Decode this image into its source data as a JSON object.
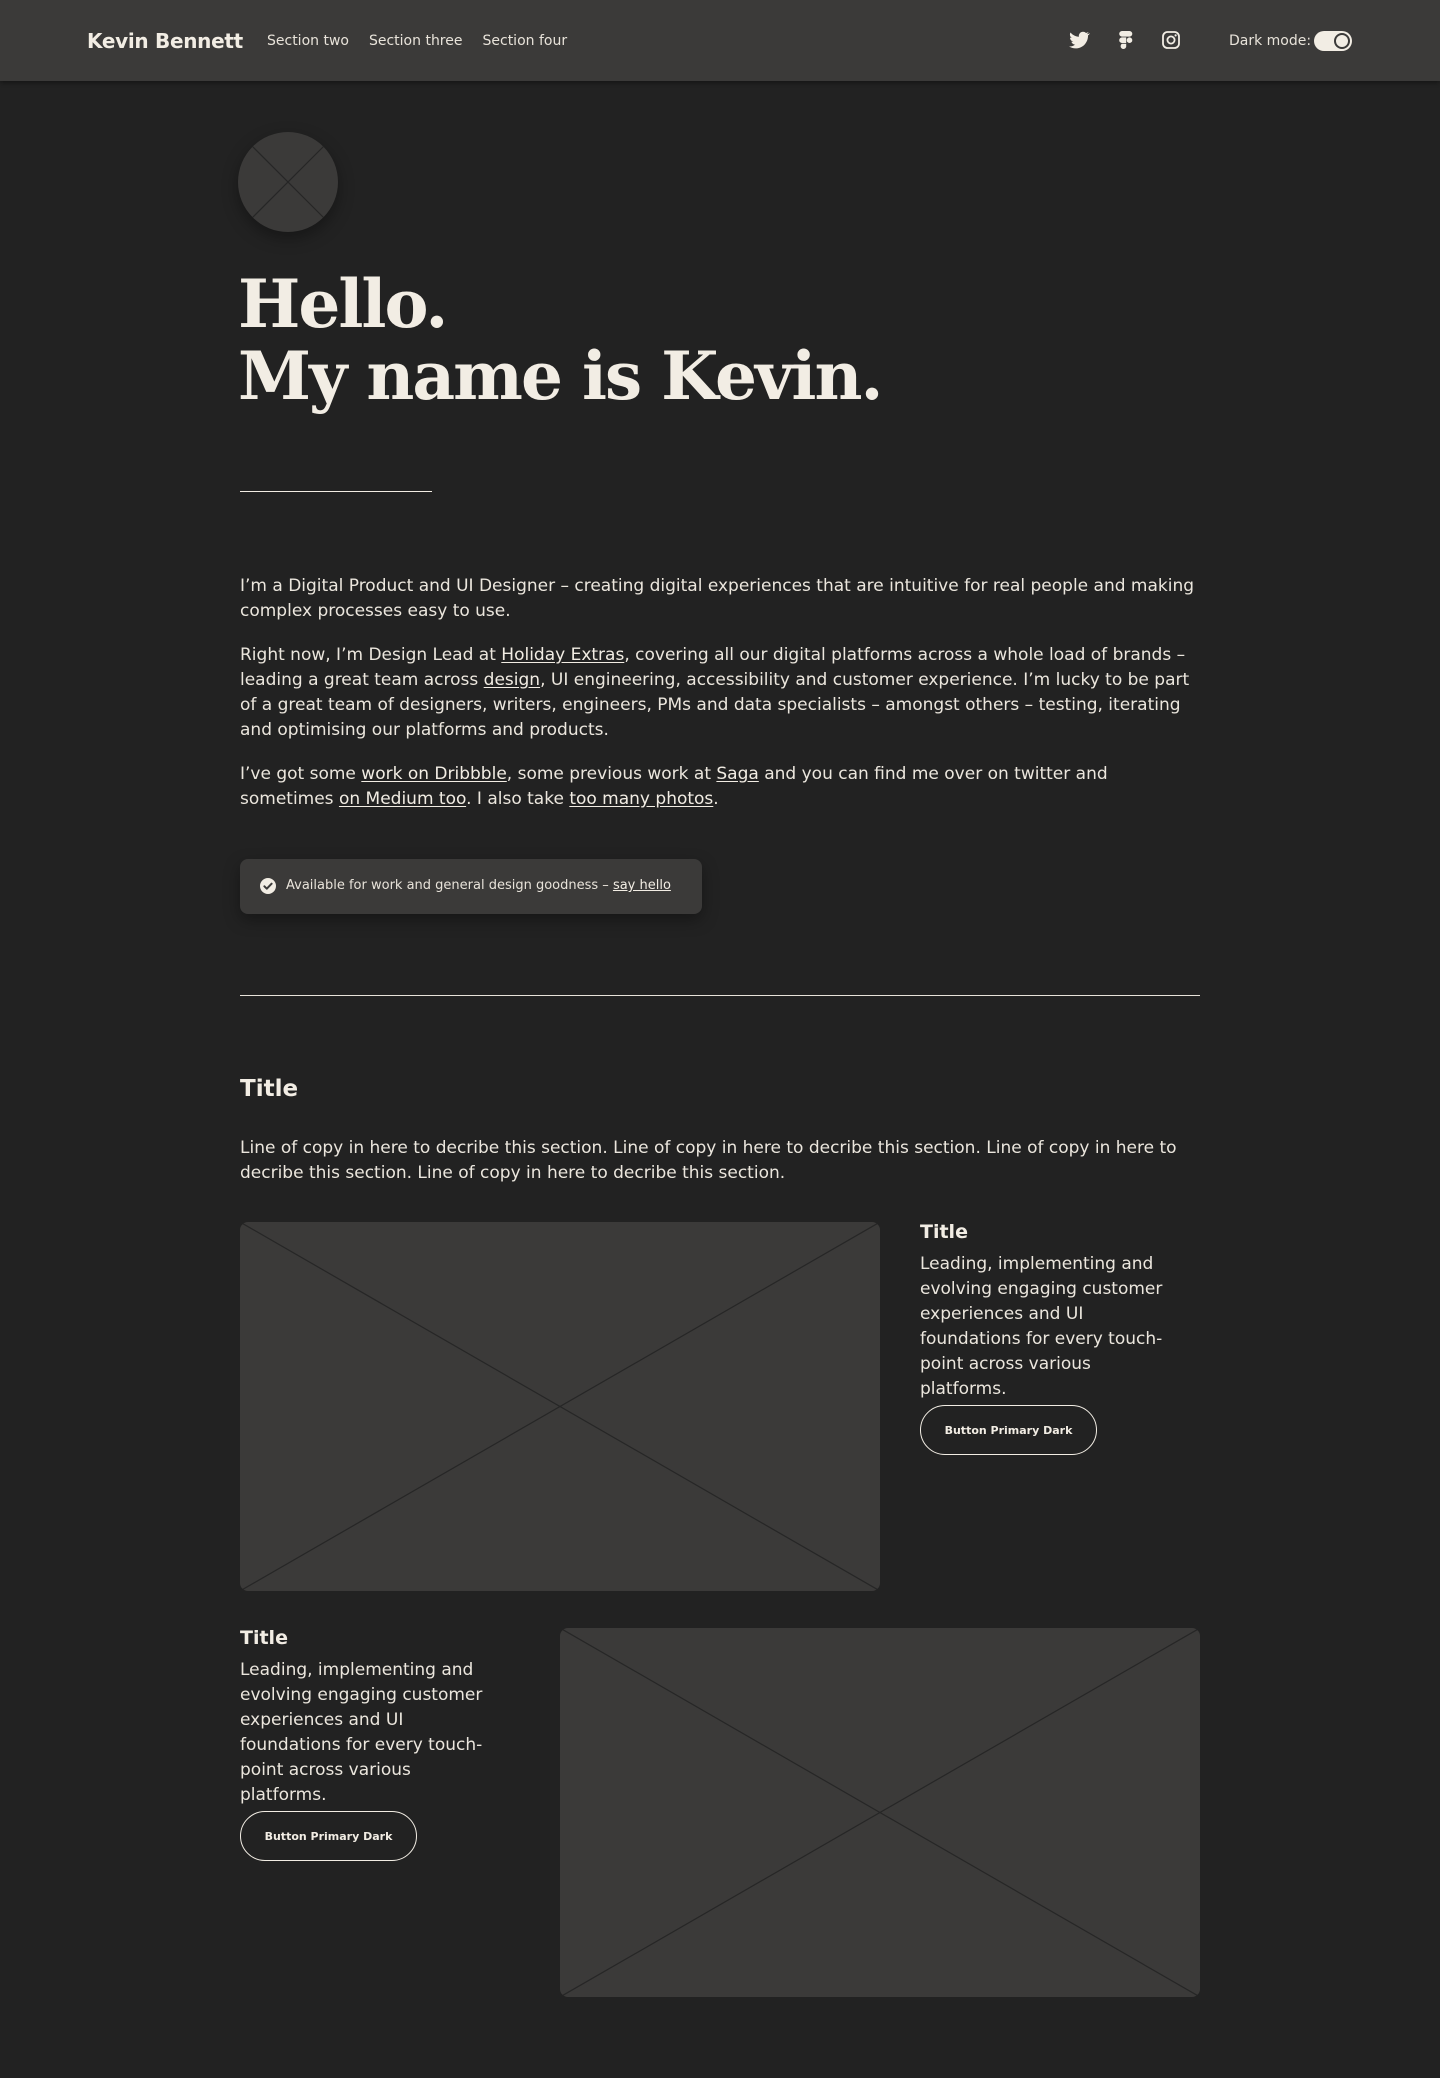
{
  "nav": {
    "brand": "Kevin Bennett",
    "links": [
      "Section two",
      "Section three",
      "Section four"
    ],
    "social_icons": [
      "twitter-icon",
      "figma-icon",
      "instagram-icon"
    ],
    "dark_mode_label": "Dark mode:",
    "dark_mode_on": true
  },
  "hero": {
    "line1": "Hello.",
    "line2": "My name is Kevin."
  },
  "intro": {
    "p1": "I’m a Digital Product and UI Designer – creating digital experiences that are intuitive for real people and making complex processes easy to use.",
    "p2": {
      "a": "Right now, I’m Design Lead at ",
      "link1": "Holiday Extras",
      "b": ", covering all our digital platforms across a whole load of brands – leading a great team across ",
      "link2": "design",
      "c": ", UI engineering, accessibility and customer experience. I’m lucky to be part of a great team of designers, writers, engineers, PMs and data specialists – amongst others – testing, iterating and optimising our platforms and products."
    },
    "p3": {
      "a": "I’ve got some ",
      "link1": "work on Dribbble",
      "b": ", some previous work at ",
      "link2": "Saga",
      "c": " and you can find me over on twitter and sometimes ",
      "link3": "on Medium too",
      "d": ". I also take ",
      "link4": "too many photos",
      "e": "."
    }
  },
  "status": {
    "text": "Available for work and general design goodness – ",
    "link": "say hello"
  },
  "section": {
    "title": "Title",
    "copy": "Line of copy in here to decribe this section. Line of copy in here to decribe this section. Line of copy in here to decribe this section. Line of copy in here to decribe this section."
  },
  "cards": [
    {
      "title": "Title",
      "text": "Leading, implementing and evolving engaging customer experiences and UI foundations for every touch-point across various platforms.",
      "button": "Button Primary Dark"
    },
    {
      "title": "Title",
      "text": "Leading, implementing and evolving engaging customer experiences and UI foundations for every touch-point across various platforms.",
      "button": "Button Primary Dark"
    }
  ],
  "colors": {
    "background": "#222222",
    "surface": "#3b3a39",
    "text": "#f2ede4"
  }
}
